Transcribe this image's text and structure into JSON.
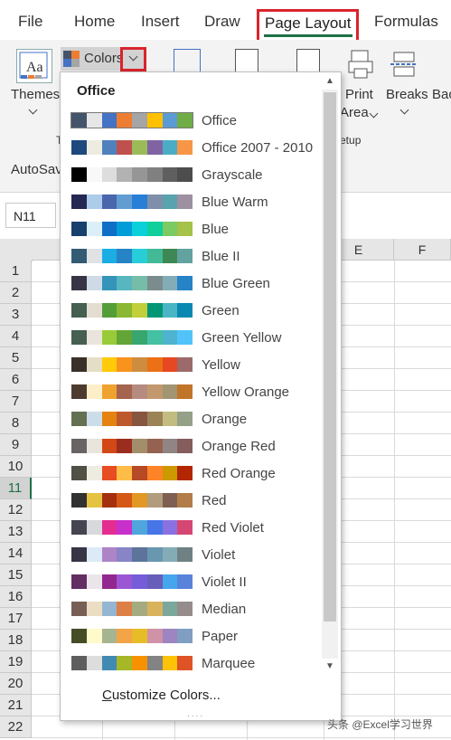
{
  "tabs": {
    "file": "File",
    "home": "Home",
    "insert": "Insert",
    "draw": "Draw",
    "page_layout": "Page Layout",
    "formulas": "Formulas"
  },
  "ribbon": {
    "themes_label": "Themes",
    "colors_label": "Colors",
    "print_label": "Print",
    "area_label": "Area",
    "breaks_label": "Breaks",
    "background_label": "Bac",
    "group_t": "T",
    "page_setup_group": "e Setup"
  },
  "autosave_label": "AutoSav",
  "namebox_value": "N11",
  "grid": {
    "columns": [
      "E",
      "F"
    ],
    "rows": [
      "1",
      "2",
      "3",
      "4",
      "5",
      "6",
      "7",
      "8",
      "9",
      "10",
      "11",
      "12",
      "13",
      "14",
      "15",
      "16",
      "17",
      "18",
      "19",
      "20",
      "21",
      "22"
    ],
    "selected_row": "11"
  },
  "dropdown": {
    "header": "Office",
    "items": [
      {
        "label": "Office",
        "colors": [
          "#44546a",
          "#e7e6e6",
          "#4472c4",
          "#ed7d31",
          "#a5a5a5",
          "#ffc000",
          "#5b9bd5",
          "#70ad47"
        ]
      },
      {
        "label": "Office 2007 - 2010",
        "colors": [
          "#1f497d",
          "#eeece1",
          "#4f81bd",
          "#c0504d",
          "#9bbb59",
          "#8064a2",
          "#4bacc6",
          "#f79646"
        ]
      },
      {
        "label": "Grayscale",
        "colors": [
          "#000000",
          "#f8f8f8",
          "#dddddd",
          "#b2b2b2",
          "#969696",
          "#808080",
          "#5f5f5f",
          "#4d4d4d"
        ]
      },
      {
        "label": "Blue Warm",
        "colors": [
          "#242852",
          "#acccea",
          "#4a66ac",
          "#629dd1",
          "#297fd5",
          "#7f8fa9",
          "#5aa2ae",
          "#9d90a0"
        ]
      },
      {
        "label": "Blue",
        "colors": [
          "#17406d",
          "#dbeff9",
          "#0f6fc6",
          "#009dd9",
          "#0bd0d9",
          "#10cf9b",
          "#7cca62",
          "#a5c249"
        ]
      },
      {
        "label": "Blue II",
        "colors": [
          "#335b74",
          "#dfe3e5",
          "#1cade4",
          "#2683c6",
          "#27ced7",
          "#42ba97",
          "#3e8853",
          "#62a39f"
        ]
      },
      {
        "label": "Blue Green",
        "colors": [
          "#373545",
          "#ceDbe6",
          "#3494ba",
          "#58b6c0",
          "#75bda7",
          "#7a8c8e",
          "#84acb6",
          "#2683c6"
        ]
      },
      {
        "label": "Green",
        "colors": [
          "#455f51",
          "#e3ded1",
          "#549e39",
          "#8ab833",
          "#c0cf3a",
          "#029676",
          "#4ab5c4",
          "#0989b1"
        ]
      },
      {
        "label": "Green Yellow",
        "colors": [
          "#455f51",
          "#e9e5dc",
          "#99cb38",
          "#63a537",
          "#37a76f",
          "#44c1a3",
          "#4eb3cf",
          "#51c3f9"
        ]
      },
      {
        "label": "Yellow",
        "colors": [
          "#39302a",
          "#e5dec6",
          "#ffca08",
          "#f8931d",
          "#ce8d3e",
          "#ec7016",
          "#e64823",
          "#9c6a6a"
        ]
      },
      {
        "label": "Yellow Orange",
        "colors": [
          "#4e3b30",
          "#fbeec9",
          "#f0a22e",
          "#a5644e",
          "#b58b80",
          "#c3986d",
          "#a19574",
          "#c17529"
        ]
      },
      {
        "label": "Orange",
        "colors": [
          "#637052",
          "#ccddea",
          "#e48312",
          "#bd582c",
          "#865640",
          "#9b8357",
          "#c2bc80",
          "#94a088"
        ]
      },
      {
        "label": "Orange Red",
        "colors": [
          "#696464",
          "#e9e5dc",
          "#d34817",
          "#9b2d1f",
          "#a28e6a",
          "#956251",
          "#918485",
          "#855d5d"
        ]
      },
      {
        "label": "Red Orange",
        "colors": [
          "#505046",
          "#eeece1",
          "#e84c22",
          "#ffbd47",
          "#b64926",
          "#ff8427",
          "#cc9900",
          "#b22600"
        ]
      },
      {
        "label": "Red",
        "colors": [
          "#323232",
          "#e5c243",
          "#a5300f",
          "#d55816",
          "#e19825",
          "#b19c7d",
          "#7f5f52",
          "#b27d49"
        ]
      },
      {
        "label": "Red Violet",
        "colors": [
          "#454551",
          "#d8d9dc",
          "#e32d91",
          "#c830cc",
          "#4ea6dc",
          "#4775e7",
          "#8971e1",
          "#d54773"
        ]
      },
      {
        "label": "Violet",
        "colors": [
          "#373545",
          "#dceaf7",
          "#ad84c6",
          "#8784c7",
          "#5d739a",
          "#6997af",
          "#84acb6",
          "#6f8183"
        ]
      },
      {
        "label": "Violet II",
        "colors": [
          "#632e62",
          "#eae5eb",
          "#92278f",
          "#9b57d3",
          "#755dd9",
          "#665eb8",
          "#45a5ed",
          "#5982db"
        ]
      },
      {
        "label": "Median",
        "colors": [
          "#775f55",
          "#ebddc3",
          "#94b6d2",
          "#dd8047",
          "#a5ab81",
          "#d8b25c",
          "#7ba79d",
          "#968c8c"
        ]
      },
      {
        "label": "Paper",
        "colors": [
          "#444d26",
          "#fefac9",
          "#a5b592",
          "#f3a447",
          "#e7bc29",
          "#d092a7",
          "#9c85c0",
          "#809ec2"
        ]
      },
      {
        "label": "Marquee",
        "colors": [
          "#5e5e5e",
          "#dddddd",
          "#418ab3",
          "#a6b727",
          "#f69200",
          "#838383",
          "#fec306",
          "#df5327"
        ]
      }
    ],
    "customize_label": "Customize Colors...",
    "customize_underline": "C",
    "customize_rest": "ustomize Colors...",
    "grip": "....",
    "scroll_up": "▲",
    "scroll_down": "▼"
  },
  "watermark": "头条 @Excel学习世界",
  "accent": "#1e7145",
  "highlight": "#d9242c"
}
